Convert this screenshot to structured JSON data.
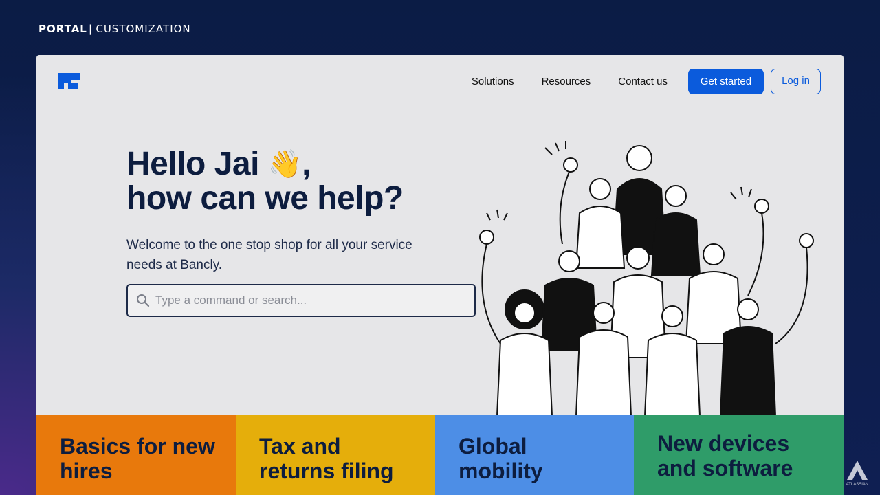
{
  "header_label": {
    "brand": "PORTAL",
    "separator": "|",
    "section": "CUSTOMIZATION"
  },
  "nav": {
    "links": [
      "Solutions",
      "Resources",
      "Contact us"
    ],
    "primary_button": "Get started",
    "secondary_button": "Log in"
  },
  "hero": {
    "title_line1": "Hello Jai",
    "wave_emoji": "👋",
    "title_comma": ",",
    "title_line2": "how can we help?",
    "subtitle": "Welcome to the one stop shop for all your service needs at Bancly."
  },
  "search": {
    "placeholder": "Type a command or search..."
  },
  "tiles": [
    {
      "label": "Basics for new hires",
      "color": "#e8790c"
    },
    {
      "label": "Tax and returns filing",
      "color": "#e5ae0b"
    },
    {
      "label": "Global mobility",
      "color": "#4d8ee6"
    },
    {
      "label": "New devices and software",
      "color": "#2f9c69"
    }
  ],
  "watermark": "ATLASSIAN",
  "colors": {
    "accent": "#0b5bdc",
    "heading": "#0d1d3f"
  }
}
